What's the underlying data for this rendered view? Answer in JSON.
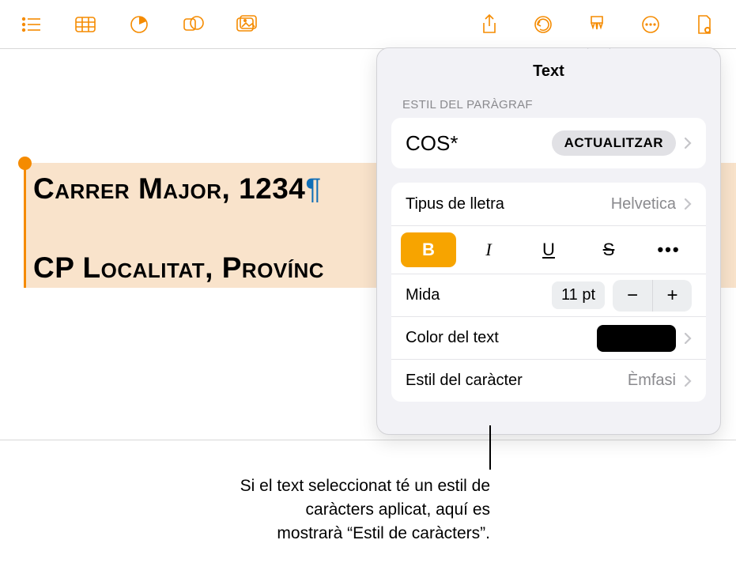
{
  "toolbar": {
    "view_icon": "view-list-icon",
    "table_icon": "table-icon",
    "chart_icon": "chart-pie-icon",
    "shape_icon": "shape-icon",
    "media_icon": "media-icon",
    "share_icon": "share-icon",
    "undo_icon": "undo-icon",
    "format_icon": "format-brush-icon",
    "more_icon": "more-icon",
    "document_icon": "document-icon"
  },
  "document": {
    "line1": "Carrer Major, 1234",
    "pilcrow": "¶",
    "line2": "CP Localitat, Provínc"
  },
  "panel": {
    "title": "Text",
    "paragraph_style_label": "ESTIL DEL PARÀGRAF",
    "style_name": "COS*",
    "update_button": "ACTUALITZAR",
    "font_label": "Tipus de lletra",
    "font_value": "Helvetica",
    "bold": "B",
    "italic": "I",
    "underline": "U",
    "strike": "S",
    "more": "•••",
    "size_label": "Mida",
    "size_value": "11 pt",
    "minus": "−",
    "plus": "+",
    "color_label": "Color del text",
    "charstyle_label": "Estil del caràcter",
    "charstyle_value": "Èmfasi"
  },
  "callout": {
    "text": "Si el text seleccionat té un estil de caràcters aplicat, aquí es mostrarà “Estil de caràcters”."
  }
}
